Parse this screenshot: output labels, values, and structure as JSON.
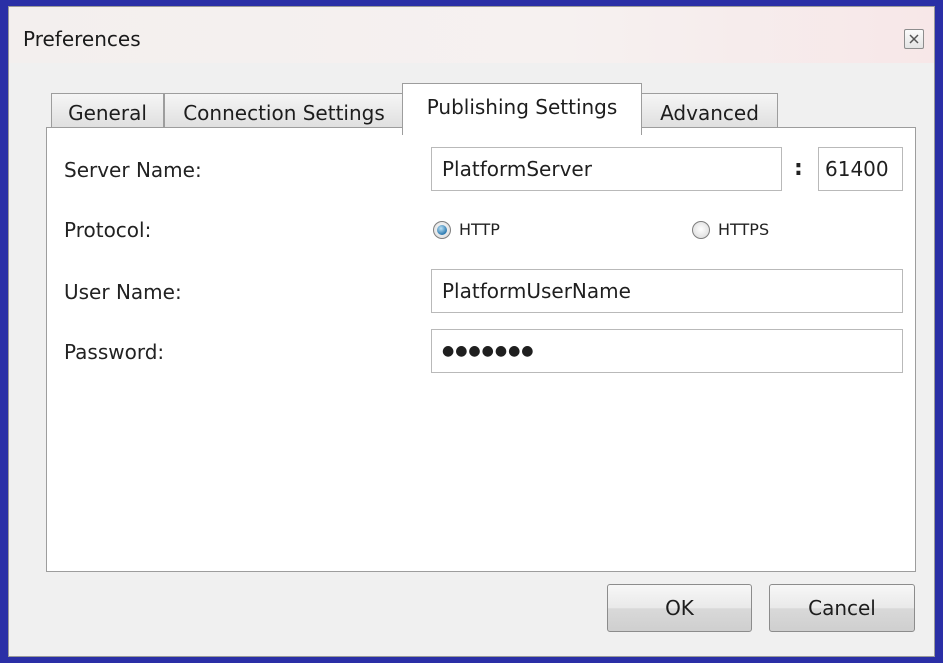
{
  "window": {
    "title": "Preferences",
    "close_icon": "close-icon"
  },
  "tabs": [
    {
      "label": "General"
    },
    {
      "label": "Connection Settings"
    },
    {
      "label": "Publishing Settings",
      "active": true
    },
    {
      "label": "Advanced"
    }
  ],
  "form": {
    "server_name_label": "Server Name:",
    "server_name_value": "PlatformServer",
    "port_separator": ":",
    "port_value": "61400",
    "protocol_label": "Protocol:",
    "protocol_options": [
      "HTTP",
      "HTTPS"
    ],
    "protocol_selected": "HTTP",
    "user_name_label": "User Name:",
    "user_name_value": "PlatformUserName",
    "password_label": "Password:",
    "password_masked": "●●●●●●●"
  },
  "buttons": {
    "ok_label": "OK",
    "cancel_label": "Cancel"
  },
  "colors": {
    "window_border": "#2a2fa6",
    "radio_accent": "#2b79b0"
  }
}
